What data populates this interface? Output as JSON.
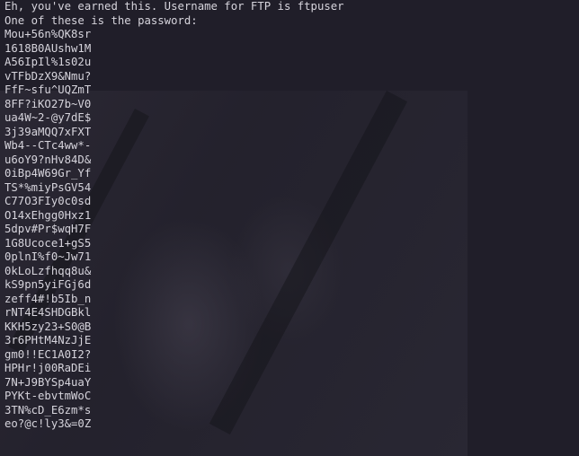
{
  "terminal": {
    "header_line_1": "Eh, you've earned this. Username for FTP is ftpuser",
    "header_line_2": "One of these is the password:",
    "passwords": [
      "Mou+56n%QK8sr",
      "1618B0AUshw1M",
      "A56IpIl%1s02u",
      "vTFbDzX9&Nmu?",
      "FfF~sfu^UQZmT",
      "8FF?iKO27b~V0",
      "ua4W~2-@y7dE$",
      "3j39aMQQ7xFXT",
      "Wb4--CTc4ww*-",
      "u6oY9?nHv84D&",
      "0iBp4W69Gr_Yf",
      "TS*%miyPsGV54",
      "C77O3FIy0c0sd",
      "O14xEhgg0Hxz1",
      "5dpv#Pr$wqH7F",
      "1G8Ucoce1+gS5",
      "0plnI%f0~Jw71",
      "0kLoLzfhqq8u&",
      "kS9pn5yiFGj6d",
      "zeff4#!b5Ib_n",
      "rNT4E4SHDGBkl",
      "KKH5zy23+S0@B",
      "3r6PHtM4NzJjE",
      "gm0!!EC1A0I2?",
      "HPHr!j00RaDEi",
      "7N+J9BYSp4uaY",
      "PYKt-ebvtmWoC",
      "3TN%cD_E6zm*s",
      "eo?@c!ly3&=0Z"
    ]
  }
}
